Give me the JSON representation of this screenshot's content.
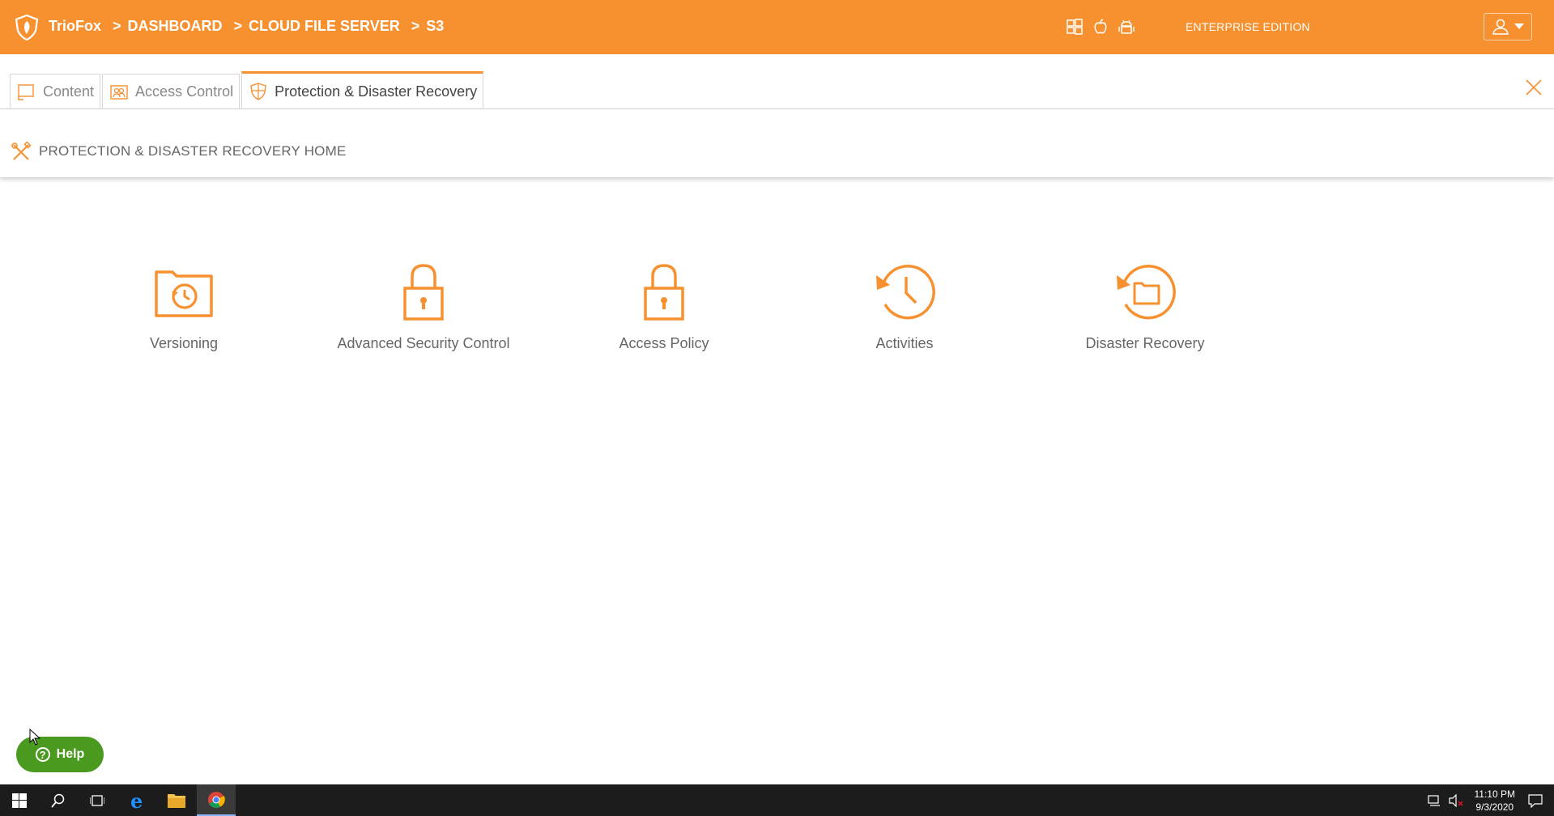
{
  "header": {
    "brand": "TrioFox",
    "crumbs": [
      "DASHBOARD",
      "CLOUD FILE SERVER",
      "S3"
    ],
    "separator": ">",
    "edition": "ENTERPRISE EDITION",
    "platform_icons": [
      "windows-icon",
      "apple-icon",
      "android-icon"
    ],
    "accent_color": "#f7902f"
  },
  "tabs": [
    {
      "label": "Content",
      "icon": "monitor-icon",
      "active": false
    },
    {
      "label": "Access Control",
      "icon": "users-icon",
      "active": false
    },
    {
      "label": "Protection & Disaster Recovery",
      "icon": "shield-icon",
      "active": true
    }
  ],
  "section": {
    "title": "PROTECTION & DISASTER RECOVERY HOME",
    "icon": "tools-icon"
  },
  "features": [
    {
      "label": "Versioning",
      "icon": "folder-history-icon"
    },
    {
      "label": "Advanced Security Control",
      "icon": "lock-icon"
    },
    {
      "label": "Access Policy",
      "icon": "lock-icon"
    },
    {
      "label": "Activities",
      "icon": "history-clock-icon"
    },
    {
      "label": "Disaster Recovery",
      "icon": "folder-restore-icon"
    }
  ],
  "help": {
    "label": "Help",
    "color": "#4a9a1f"
  },
  "taskbar": {
    "time": "11:10 PM",
    "date": "9/3/2020"
  }
}
